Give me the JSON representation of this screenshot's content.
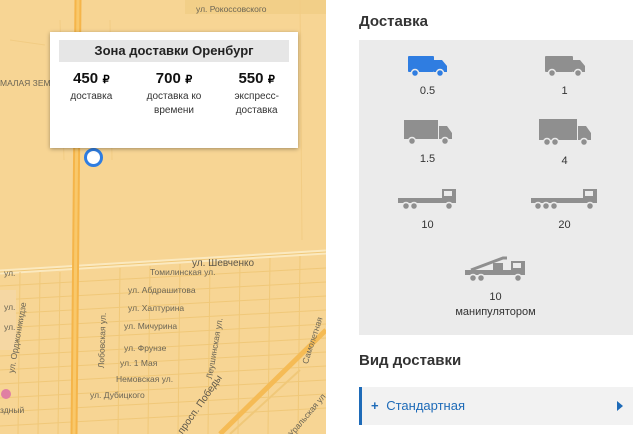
{
  "map": {
    "popup": {
      "title": "Зона доставки Оренбург",
      "rates": [
        {
          "price": "450",
          "currency": "₽",
          "label": "доставка"
        },
        {
          "price": "700",
          "currency": "₽",
          "label": "доставка ко времени"
        },
        {
          "price": "550",
          "currency": "₽",
          "label": "экспресс-доставка"
        }
      ]
    },
    "streets": {
      "rokossovskogo": "ул. Рокоссовского",
      "malaya_zemlya": "МАЛАЯ ЗЕМЛ",
      "shevchenko": "ул. Шевченко",
      "tomilinskaya": "Томилинская ул.",
      "abdrashitova": "ул. Абдрашитова",
      "khalturina": "ул. Халтурина",
      "michurina": "ул. Мичурина",
      "frunze": "ул. Фрунзе",
      "may1": "ул. 1 Мая",
      "nemovskaya": "Немовская ул.",
      "dubitskogo": "ул. Дубицкого",
      "ordzhonikidze": "ул. Орджоникидзе",
      "lobovskaya": "Лобовская ул.",
      "pobedy": "просп. Победы",
      "leushinskaya": "Леушинская ул.",
      "samoletnaya": "Самолетная",
      "uralskaya": "Уральская ул.",
      "ul1": "ул.",
      "ul2": "ул.",
      "ul3": "ул.",
      "zdny": "здный"
    }
  },
  "panel": {
    "delivery_title": "Доставка",
    "trucks": [
      {
        "label": "0.5",
        "icon": "small-van-icon",
        "active": true
      },
      {
        "label": "1",
        "icon": "van-icon",
        "active": false
      },
      {
        "label": "1.5",
        "icon": "box-truck-icon",
        "active": false
      },
      {
        "label": "4",
        "icon": "box-truck-large-icon",
        "active": false
      },
      {
        "label": "10",
        "icon": "flatbed-truck-icon",
        "active": false
      },
      {
        "label": "20",
        "icon": "long-flatbed-truck-icon",
        "active": false
      },
      {
        "label": "10",
        "sublabel": "манипулятором",
        "icon": "crane-truck-icon",
        "active": false
      }
    ],
    "delivery_type_title": "Вид доставки",
    "delivery_type_option": "Стандартная",
    "colors": {
      "active": "#2f7de1",
      "inactive": "#8f8f8f",
      "accent": "#1e6bb8",
      "map": "#f7d594"
    }
  }
}
